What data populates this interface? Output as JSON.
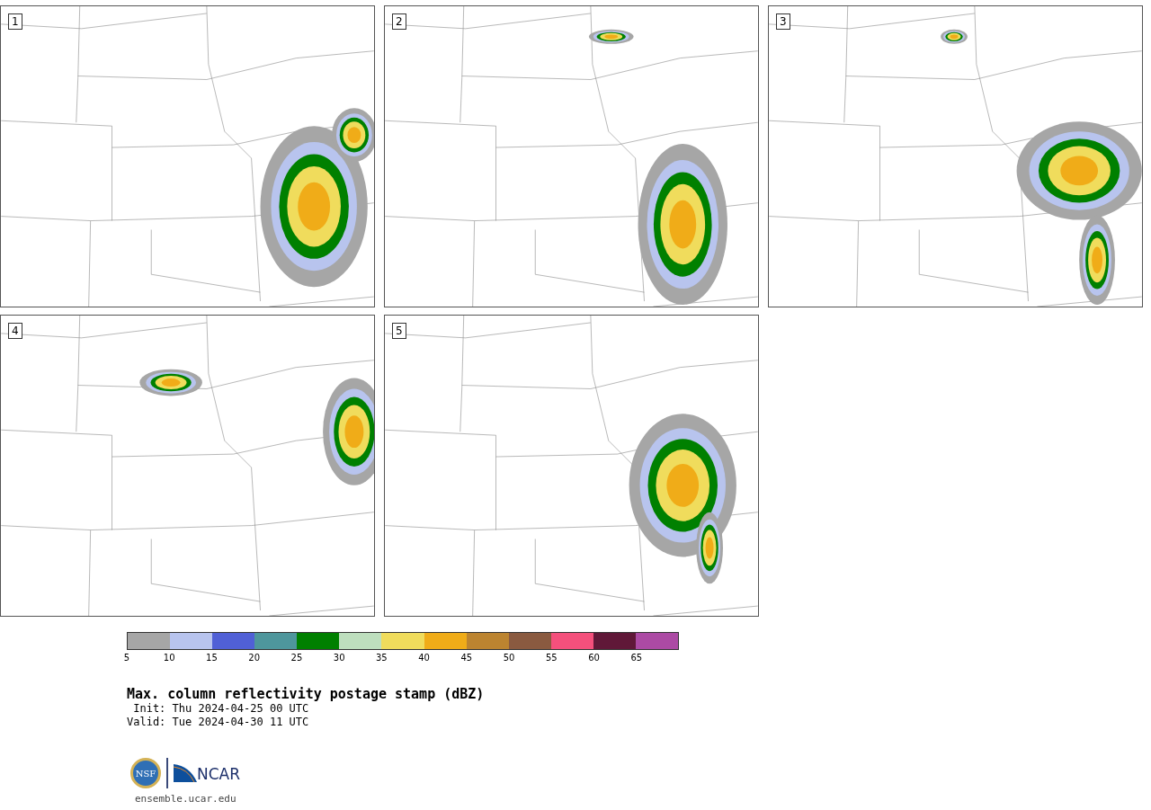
{
  "panels": [
    {
      "number": "1"
    },
    {
      "number": "2"
    },
    {
      "number": "3"
    },
    {
      "number": "4"
    },
    {
      "number": "5"
    }
  ],
  "colorbar": {
    "bins": [
      {
        "color": "#a6a6a6"
      },
      {
        "color": "#b8c4ee"
      },
      {
        "color": "#5060d6"
      },
      {
        "color": "#4e969c"
      },
      {
        "color": "#008000"
      },
      {
        "color": "#bedfbe"
      },
      {
        "color": "#f0dc5c"
      },
      {
        "color": "#f0ac18"
      },
      {
        "color": "#bc8430"
      },
      {
        "color": "#8a5a40"
      },
      {
        "color": "#f4507c"
      },
      {
        "color": "#601838"
      },
      {
        "color": "#ac4aa4"
      }
    ],
    "ticks": [
      "5",
      "10",
      "15",
      "20",
      "25",
      "30",
      "35",
      "40",
      "45",
      "50",
      "55",
      "60",
      "65"
    ]
  },
  "title": "Max. column reflectivity postage stamp (dBZ)",
  "init": " Init: Thu 2024-04-25 00 UTC",
  "valid": "Valid: Tue 2024-04-30 11 UTC",
  "logos": {
    "nsf": "NSF",
    "ncar": "NCAR"
  },
  "url": "ensemble.ucar.edu"
}
